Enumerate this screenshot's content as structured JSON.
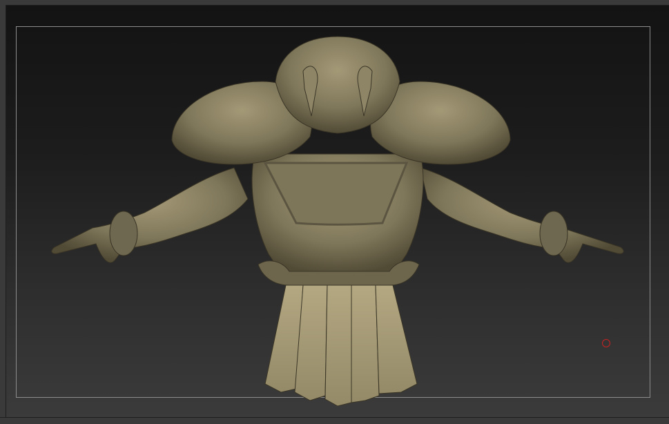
{
  "app": {
    "name": "sculpt-viewport"
  },
  "canvas": {
    "background": "dark gradient",
    "model": "armored-warrior-bust",
    "material_color": "#8a8160",
    "frame_color": "#8d8d8d",
    "cursor_color": "#cc2222"
  },
  "icons": {
    "brush_cursor": "circle-cursor-icon"
  }
}
